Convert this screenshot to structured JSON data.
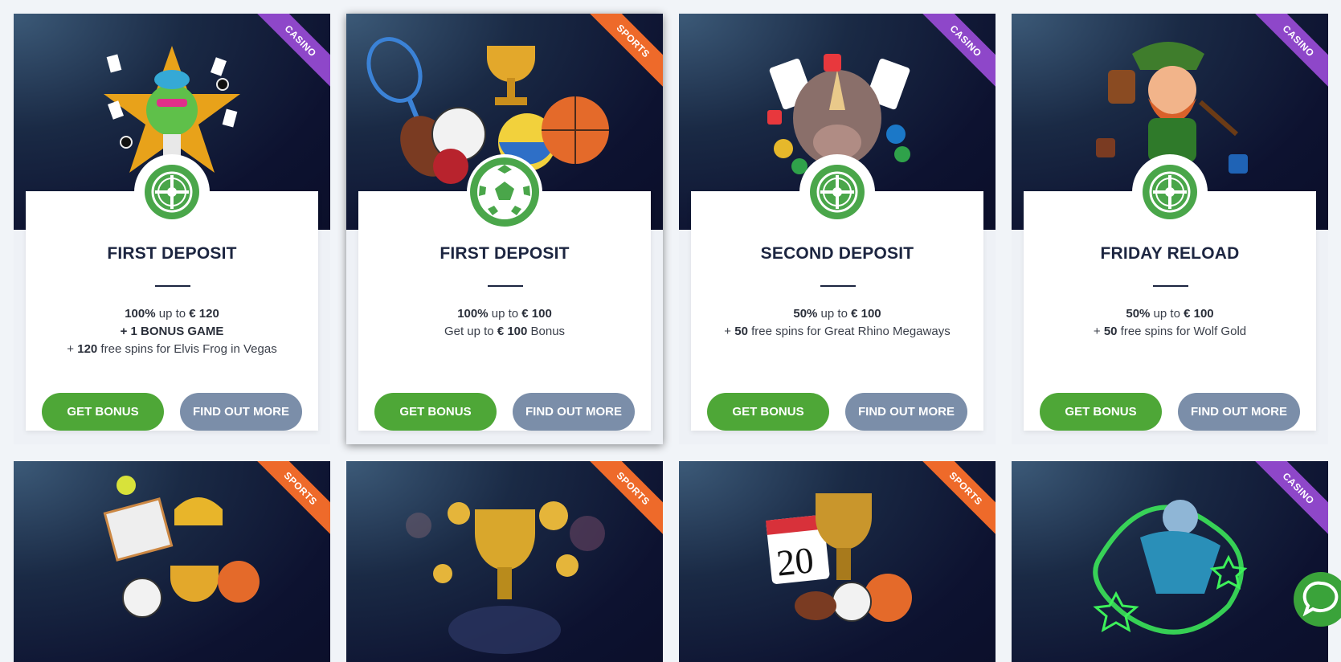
{
  "cards": [
    {
      "tag": "CASINO",
      "title": "FIRST DEPOSIT",
      "line1_pct": "100%",
      "line1_mid": " up to ",
      "line1_amt": "€ 120",
      "line2": "+ 1 BONUS GAME",
      "line3_pre": "+ ",
      "line3_num": "120",
      "line3_rest": " free spins for Elvis Frog in Vegas",
      "get_label": "GET BONUS",
      "more_label": "FIND OUT MORE"
    },
    {
      "tag": "SPORTS",
      "title": "FIRST DEPOSIT",
      "line1_pct": "100%",
      "line1_mid": " up to ",
      "line1_amt": "€ 100",
      "line2_pre": "Get up to ",
      "line2_amt": "€ 100",
      "line2_rest": " Bonus",
      "get_label": "GET BONUS",
      "more_label": "FIND OUT MORE"
    },
    {
      "tag": "CASINO",
      "title": "SECOND DEPOSIT",
      "line1_pct": "50%",
      "line1_mid": " up to ",
      "line1_amt": "€ 100",
      "line2_pre": "+ ",
      "line2_num": "50",
      "line2_rest": " free spins for Great Rhino Megaways",
      "get_label": "GET BONUS",
      "more_label": "FIND OUT MORE"
    },
    {
      "tag": "CASINO",
      "title": "FRIDAY RELOAD",
      "line1_pct": "50%",
      "line1_mid": " up to ",
      "line1_amt": "€ 100",
      "line2_pre": "+ ",
      "line2_num": "50",
      "line2_rest": " free spins for Wolf Gold",
      "get_label": "GET BONUS",
      "more_label": "FIND OUT MORE"
    },
    {
      "tag": "SPORTS"
    },
    {
      "tag": "SPORTS"
    },
    {
      "tag": "SPORTS",
      "calendar_day": "20"
    },
    {
      "tag": "CASINO"
    }
  ],
  "icons": {
    "roulette": "roulette-icon",
    "soccer": "soccer-ball-icon",
    "chat": "chat-icon"
  },
  "colors": {
    "green": "#4ea737",
    "slate": "#7b8ea9",
    "casino": "#8e47c9",
    "sports": "#ee6a2a",
    "navy": "#1c2540"
  }
}
